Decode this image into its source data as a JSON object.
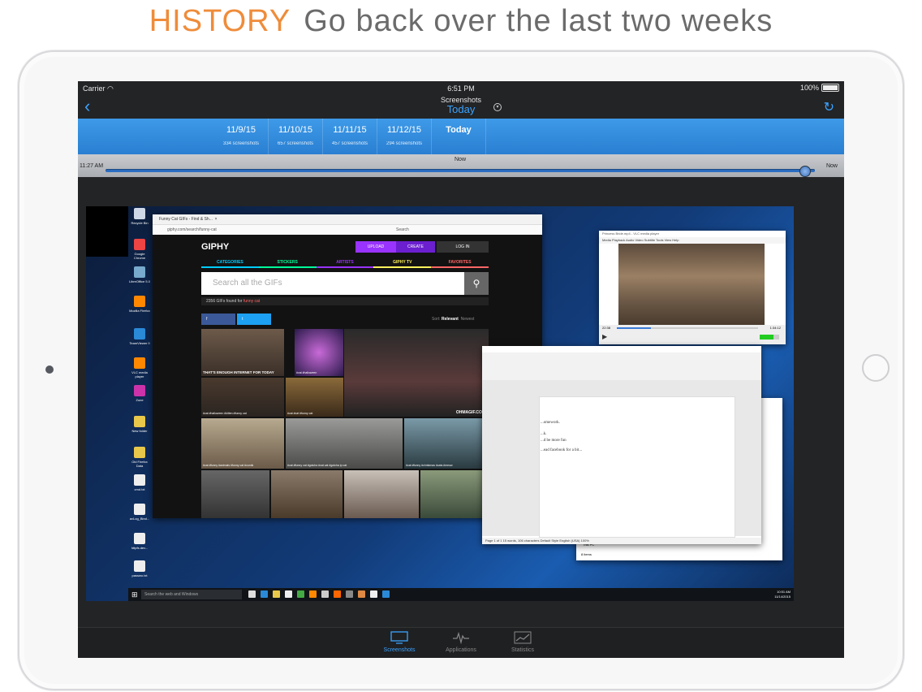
{
  "headline": {
    "accent": "HISTORY",
    "rest": "Go back over the last two weeks"
  },
  "status": {
    "carrier": "Carrier",
    "time": "6:51 PM",
    "battery": "100%"
  },
  "nav": {
    "title": "Screenshots",
    "subtitle": "Today"
  },
  "days": [
    {
      "date": "11/9/15",
      "count": "334 screenshots"
    },
    {
      "date": "11/10/15",
      "count": "657 screenshots"
    },
    {
      "date": "11/11/15",
      "count": "457 screenshots"
    },
    {
      "date": "11/12/15",
      "count": "294 screenshots"
    },
    {
      "date": "Today",
      "count": ""
    }
  ],
  "timeline": {
    "start": "11:27 AM",
    "now_label": "Now",
    "end": "Now",
    "position": 0.985
  },
  "tabs": [
    {
      "label": "Screenshots",
      "icon": "monitor-icon",
      "active": true
    },
    {
      "label": "Applications",
      "icon": "pulse-icon",
      "active": false
    },
    {
      "label": "Statistics",
      "icon": "chart-icon",
      "active": false
    }
  ],
  "desktop": {
    "icons": [
      "Recycle Bin",
      "Google Chrome",
      "LibreOffice 5.0",
      "Mozilla Firefox",
      "TeamViewer 9",
      "VLC media player",
      "Zune",
      "New folder",
      "Old Firefox Data",
      "cmd.txt",
      "avLog_Bind...",
      "httpfs.dev...",
      "passwo.txt"
    ],
    "taskbar_search": "Search the web and Windows",
    "clock_time": "10:51 AM",
    "clock_date": "11/14/2015"
  },
  "browser": {
    "tab_title": "Funny Cat GIFs - Find & Sh...",
    "url": "giphy.com/search/funny-cat",
    "search_engine_placeholder": "Search"
  },
  "giphy": {
    "logo": "GIPHY",
    "upload": "UPLOAD",
    "create": "CREATE",
    "login": "LOG IN",
    "nav": [
      {
        "label": "CATEGORIES",
        "color": "#00ccff"
      },
      {
        "label": "STICKERS",
        "color": "#00ff99"
      },
      {
        "label": "ARTISTS",
        "color": "#9933ff"
      },
      {
        "label": "GIPHY TV",
        "color": "#fff35c"
      },
      {
        "label": "FAVORITES",
        "color": "#ff6666"
      }
    ],
    "search_placeholder": "Search all the GIFs",
    "found_prefix": "2356 GIFs found for",
    "found_query": "funny cat",
    "fb": "f",
    "tw": "t",
    "sort_label": "Sort:",
    "sort_relevant": "Relevant",
    "sort_newest": "Newest",
    "gif_captions": [
      "THAT'S ENOUGH INTERNET FOR TODAY",
      "#cat #halloween",
      "OHMAGIF.COM",
      "#cat #halloween #kitten #funny cat",
      "#cat #cat #funny cat",
      "#cat #funny #animals #funny cat #comik",
      "#cat #funny cat #gotcha #cat cat #gotcha ip cat",
      "#cat #funny #christmas #cats #meow"
    ]
  },
  "vlc": {
    "title": "Princess Bride.mp4 - VLC media player",
    "menu": "Media  Playback  Audio  Video  Subtitle  Tools  View  Help",
    "elapsed": "22:38",
    "total": "1:34:12",
    "progress": 0.24
  },
  "writer": {
    "lines": [
      "...omework.",
      "...k.",
      "...d be more fun",
      "...ead facebook for a bit..."
    ],
    "status": "Page 1 of 1     15 words, 106 characters     Default Style     English (USA)                                        100%"
  },
  "explorer": {
    "item": "This PC",
    "count": "8 items"
  }
}
